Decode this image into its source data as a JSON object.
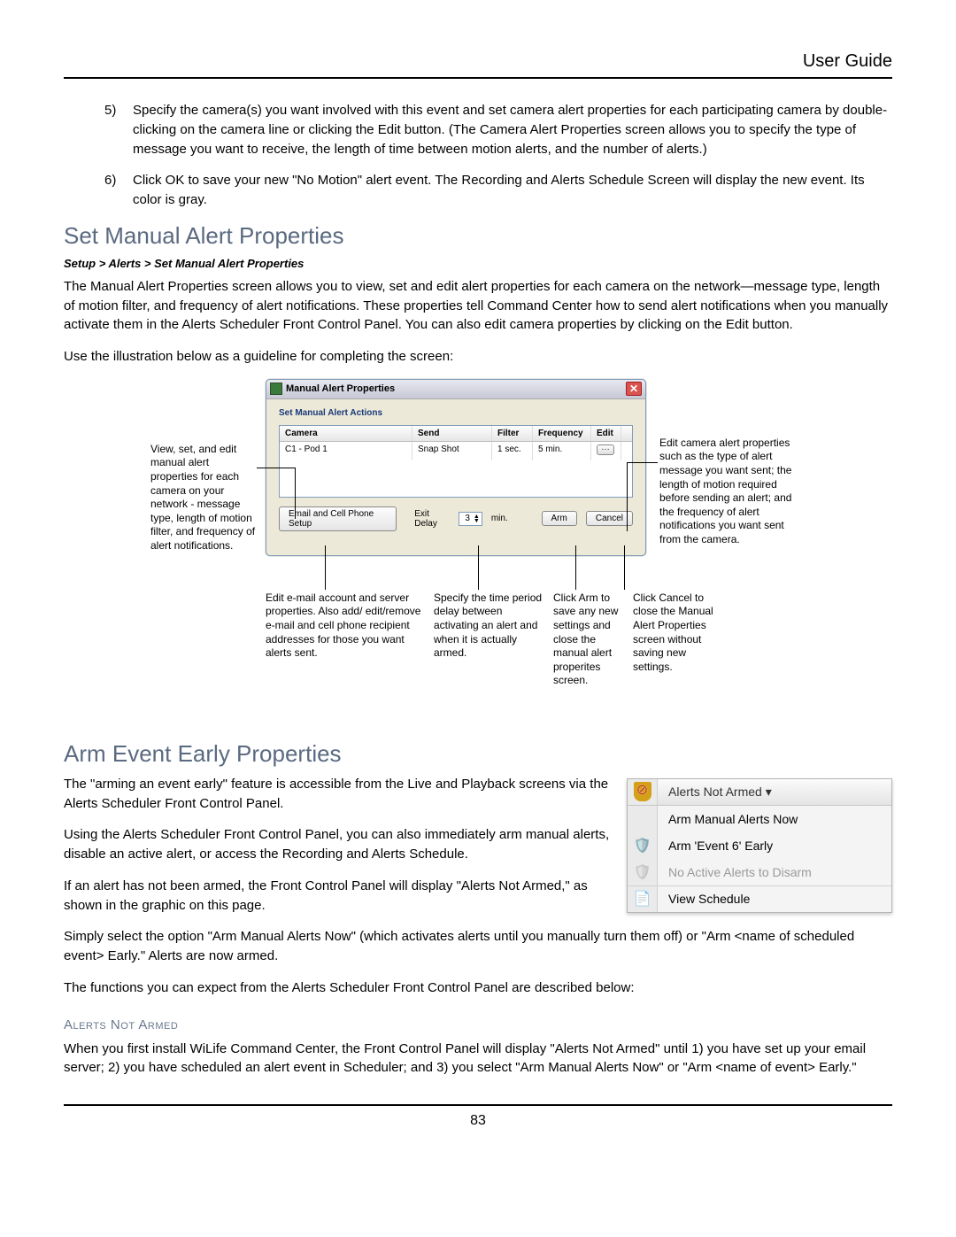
{
  "header": {
    "right": "User Guide"
  },
  "list": {
    "n5": "5)",
    "t5": "Specify the camera(s) you want involved with this event and set camera alert properties for each participating camera by double-clicking on the camera line or clicking the Edit button.  (The Camera Alert Properties screen allows you to specify the type of message you want to receive, the length of time between motion alerts, and the number of alerts.)",
    "n6": "6)",
    "t6": "Click OK to save your new \"No Motion\" alert event. The Recording and Alerts Schedule Screen will display the new event. Its color is gray."
  },
  "sec1": {
    "title": "Set Manual Alert Properties",
    "crumb": "Setup > Alerts > Set Manual Alert Properties",
    "p1": "The Manual Alert Properties screen allows you to view, set and edit alert properties for each camera on the network—message type, length of motion filter, and frequency of alert notifications.  These properties tell Command Center how to send alert notifications when you manually activate them in the Alerts Scheduler Front Control Panel.  You can also edit camera properties by clicking on the Edit button.",
    "p2": "Use the illustration below as a guideline for completing the screen:"
  },
  "fig1": {
    "title": "Manual Alert Properties",
    "subhead": "Set Manual Alert Actions",
    "cols": {
      "camera": "Camera",
      "send": "Send",
      "filter": "Filter",
      "frequency": "Frequency",
      "edit": "Edit"
    },
    "row": {
      "camera": "C1 - Pod 1",
      "send": "Snap Shot",
      "filter": "1 sec.",
      "frequency": "5 min."
    },
    "btn_email": "Email and Cell Phone Setup",
    "exit_label": "Exit Delay",
    "exit_value": "3",
    "exit_unit": "min.",
    "btn_arm": "Arm",
    "btn_cancel": "Cancel",
    "callouts": {
      "left": "View, set, and edit manual alert properties for each camera on your network - message type, length of motion filter, and frequency of alert notifications.",
      "right": "Edit camera alert properties such as the type of alert message you want sent; the length of motion required before sending an alert; and the frequency of alert notifications you want sent from the camera.",
      "b_email": "Edit e-mail account and server properties. Also add/ edit/remove e-mail and cell phone recipient addresses for those you want alerts sent.",
      "b_delay": "Specify the time period delay between activating an alert and when it is actually armed.",
      "b_arm": "Click Arm to save any new settings and close the manual alert properites screen.",
      "b_cancel": "Click Cancel to close the Manual Alert Properties screen without saving new settings."
    }
  },
  "sec2": {
    "title": "Arm Event Early Properties",
    "p1": "The \"arming an event early\" feature is accessible from the Live and Playback screens via the Alerts Scheduler Front Control Panel.",
    "p2": "Using the Alerts Scheduler Front Control Panel, you can also immediately arm manual alerts, disable an active alert, or access the Recording and Alerts Schedule.",
    "p3": "If an alert has not been armed, the Front Control Panel will display \"Alerts Not Armed,\" as shown in the graphic on this page.",
    "p4": "Simply select the option \"Arm Manual Alerts Now\" (which activates alerts until you manually turn them off) or \"Arm <name of scheduled event> Early.\"  Alerts are now armed.",
    "p5": "The functions you can expect from the Alerts Scheduler Front Control Panel are described below:"
  },
  "fig2": {
    "header": "Alerts Not Armed  ▾",
    "item1": "Arm Manual Alerts Now",
    "item2": "Arm 'Event 6' Early",
    "item3": "No Active Alerts to Disarm",
    "item4": "View Schedule"
  },
  "sub": {
    "title": "Alerts Not Armed",
    "p": "When you first install WiLife Command Center, the Front Control Panel will display \"Alerts Not Armed\" until 1) you have set up your email server; 2) you have scheduled an alert event in Scheduler; and 3) you select \"Arm Manual Alerts Now\" or \"Arm <name of event> Early.\""
  },
  "page_num": "83"
}
